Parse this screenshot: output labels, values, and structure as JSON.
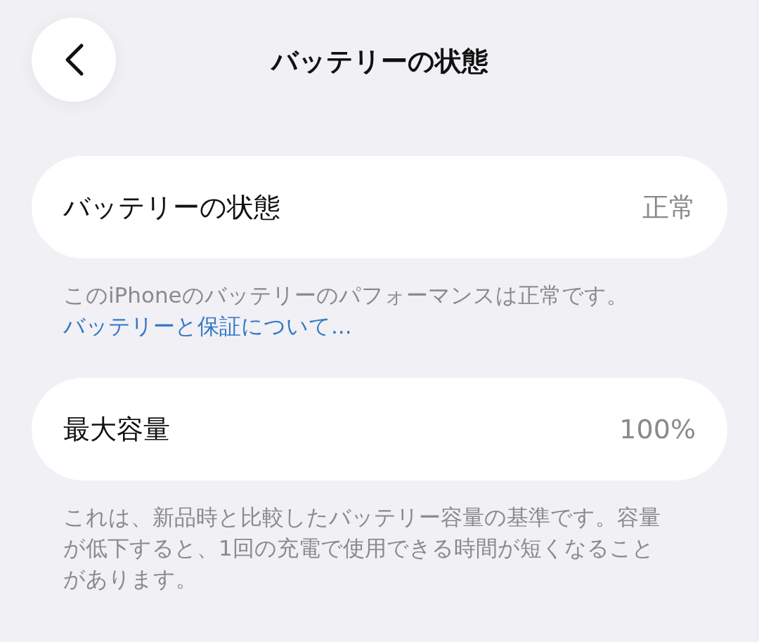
{
  "nav": {
    "title": "バッテリーの状態"
  },
  "sections": [
    {
      "row": {
        "label": "バッテリーの状態",
        "value": "正常"
      },
      "footer": "このiPhoneのバッテリーのパフォーマンスは正常です。",
      "link": "バッテリーと保証について..."
    },
    {
      "row": {
        "label": "最大容量",
        "value": "100%"
      },
      "footer": "これは、新品時と比較したバッテリー容量の基準です。容量が低下すると、1回の充電で使用できる時間が短くなることがあります。"
    }
  ]
}
